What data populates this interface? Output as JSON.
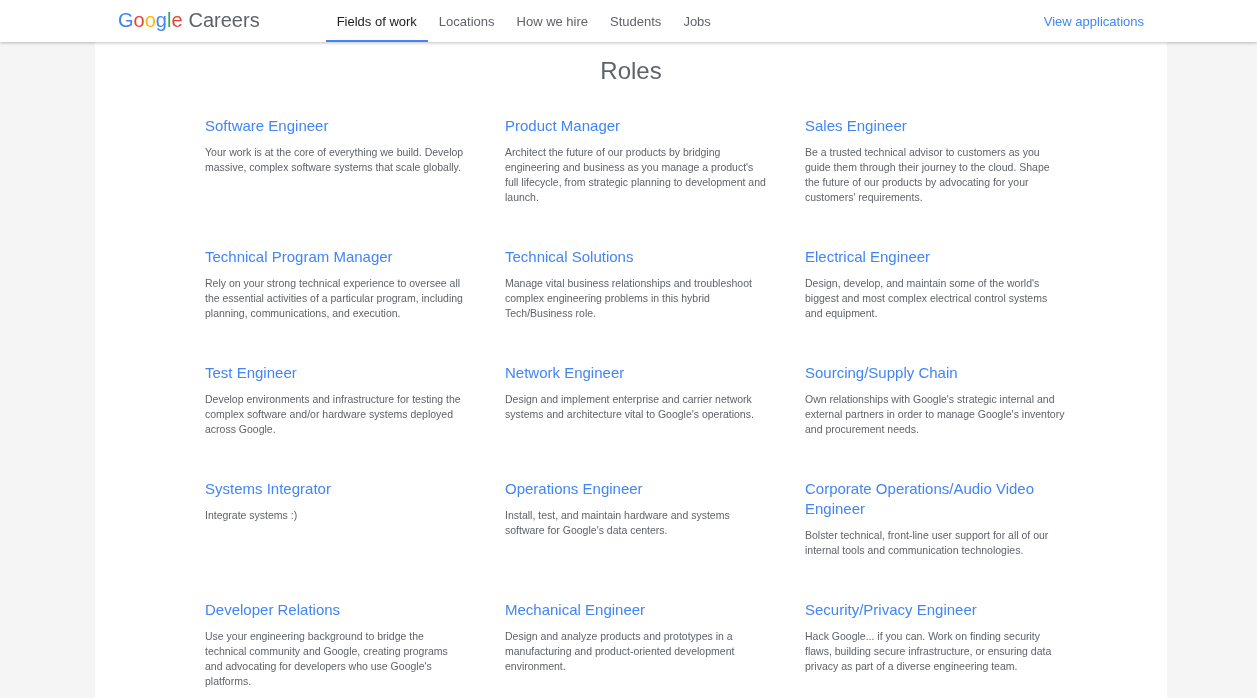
{
  "header": {
    "logo": {
      "brand": "Google",
      "product": "Careers"
    },
    "nav": [
      {
        "label": "Fields of work",
        "selected": true
      },
      {
        "label": "Locations",
        "selected": false
      },
      {
        "label": "How we hire",
        "selected": false
      },
      {
        "label": "Students",
        "selected": false
      },
      {
        "label": "Jobs",
        "selected": false
      }
    ],
    "action": "View applications"
  },
  "title": "Roles",
  "roles": [
    {
      "title": "Software Engineer",
      "description": "Your work is at the core of everything we build. Develop massive, complex software systems that scale globally."
    },
    {
      "title": "Product Manager",
      "description": "Architect the future of our products by bridging engineering and business as you manage a product's full lifecycle, from strategic planning to development and launch."
    },
    {
      "title": "Sales Engineer",
      "description": "Be a trusted technical advisor to customers as you guide them through their journey to the cloud. Shape the future of our products by advocating for your customers' requirements."
    },
    {
      "title": "Technical Program Manager",
      "description": "Rely on your strong technical experience to oversee all the essential activities of a particular program, including planning, communications, and execution."
    },
    {
      "title": "Technical Solutions",
      "description": "Manage vital business relationships and troubleshoot complex engineering problems in this hybrid Tech/Business role."
    },
    {
      "title": "Electrical Engineer",
      "description": "Design, develop, and maintain some of the world's biggest and most complex electrical control systems and equipment."
    },
    {
      "title": "Test Engineer",
      "description": "Develop environments and infrastructure for testing the complex software and/or hardware systems deployed across Google."
    },
    {
      "title": "Network Engineer",
      "description": "Design and implement enterprise and carrier network systems and architecture vital to Google's operations."
    },
    {
      "title": "Sourcing/Supply Chain",
      "description": "Own relationships with Google's strategic internal and external partners in order to manage Google's inventory and procurement needs."
    },
    {
      "title": "Systems Integrator",
      "description": "Integrate systems :)"
    },
    {
      "title": "Operations Engineer",
      "description": "Install, test, and maintain hardware and systems software for Google's data centers."
    },
    {
      "title": "Corporate Operations/Audio Video Engineer",
      "description": "Bolster technical, front-line user support for all of our internal tools and communication technologies."
    },
    {
      "title": "Developer Relations",
      "description": "Use your engineering background to bridge the technical community and Google, creating programs and advocating for developers who use Google's platforms."
    },
    {
      "title": "Mechanical Engineer",
      "description": "Design and analyze products and prototypes in a manufacturing and product-oriented development environment."
    },
    {
      "title": "Security/Privacy Engineer",
      "description": "Hack Google... if you can. Work on finding security flaws, building secure infrastructure, or ensuring data privacy as part of a diverse engineering team."
    }
  ]
}
